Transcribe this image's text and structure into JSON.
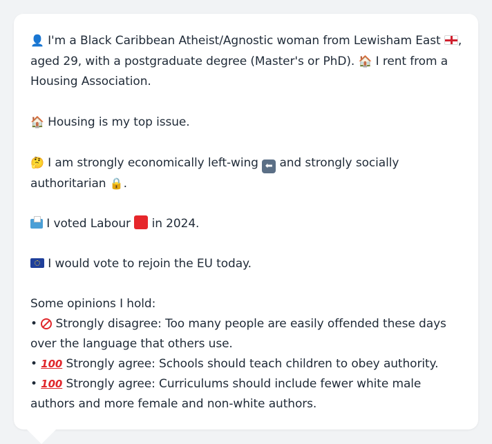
{
  "intro": {
    "part1": " I'm a Black Caribbean Atheist/Agnostic woman from Lewisham East ",
    "part2": ", aged 29, with a postgraduate degree (Master's or PhD). ",
    "part3": " I rent from a Housing Association."
  },
  "housing": {
    "text": " Housing is my top issue."
  },
  "economics": {
    "part1": " I am strongly economically left-wing ",
    "part2": " and strongly socially authoritarian ",
    "part3": "."
  },
  "vote": {
    "part1": " I voted Labour ",
    "part2": " in 2024."
  },
  "eu": {
    "text": " I would vote to rejoin the EU today."
  },
  "opinions": {
    "heading": "Some opinions I hold:",
    "items": [
      {
        "bullet": "• ",
        "text": " Strongly disagree: Too many people are easily offended these days over the language that others use."
      },
      {
        "bullet": "• ",
        "text": " Strongly agree: Schools should teach children to obey authority."
      },
      {
        "bullet": "• ",
        "text": " Strongly agree: Curriculums should include fewer white male authors and more female and non-white authors."
      }
    ]
  },
  "icons": {
    "person": "person-icon",
    "england_flag": "england-flag-icon",
    "house": "house-icon",
    "thinking": "thinking-face-icon",
    "left_arrow": "left-arrow-icon",
    "lock": "lock-icon",
    "ballot": "ballot-box-icon",
    "red_square": "red-square-icon",
    "eu_flag": "eu-flag-icon",
    "no_entry": "no-entry-icon",
    "hundred": "hundred-points-icon"
  },
  "colors": {
    "background": "#f1f3f5",
    "card": "#ffffff",
    "text": "#1f2a37",
    "labour_red": "#e6262b"
  }
}
